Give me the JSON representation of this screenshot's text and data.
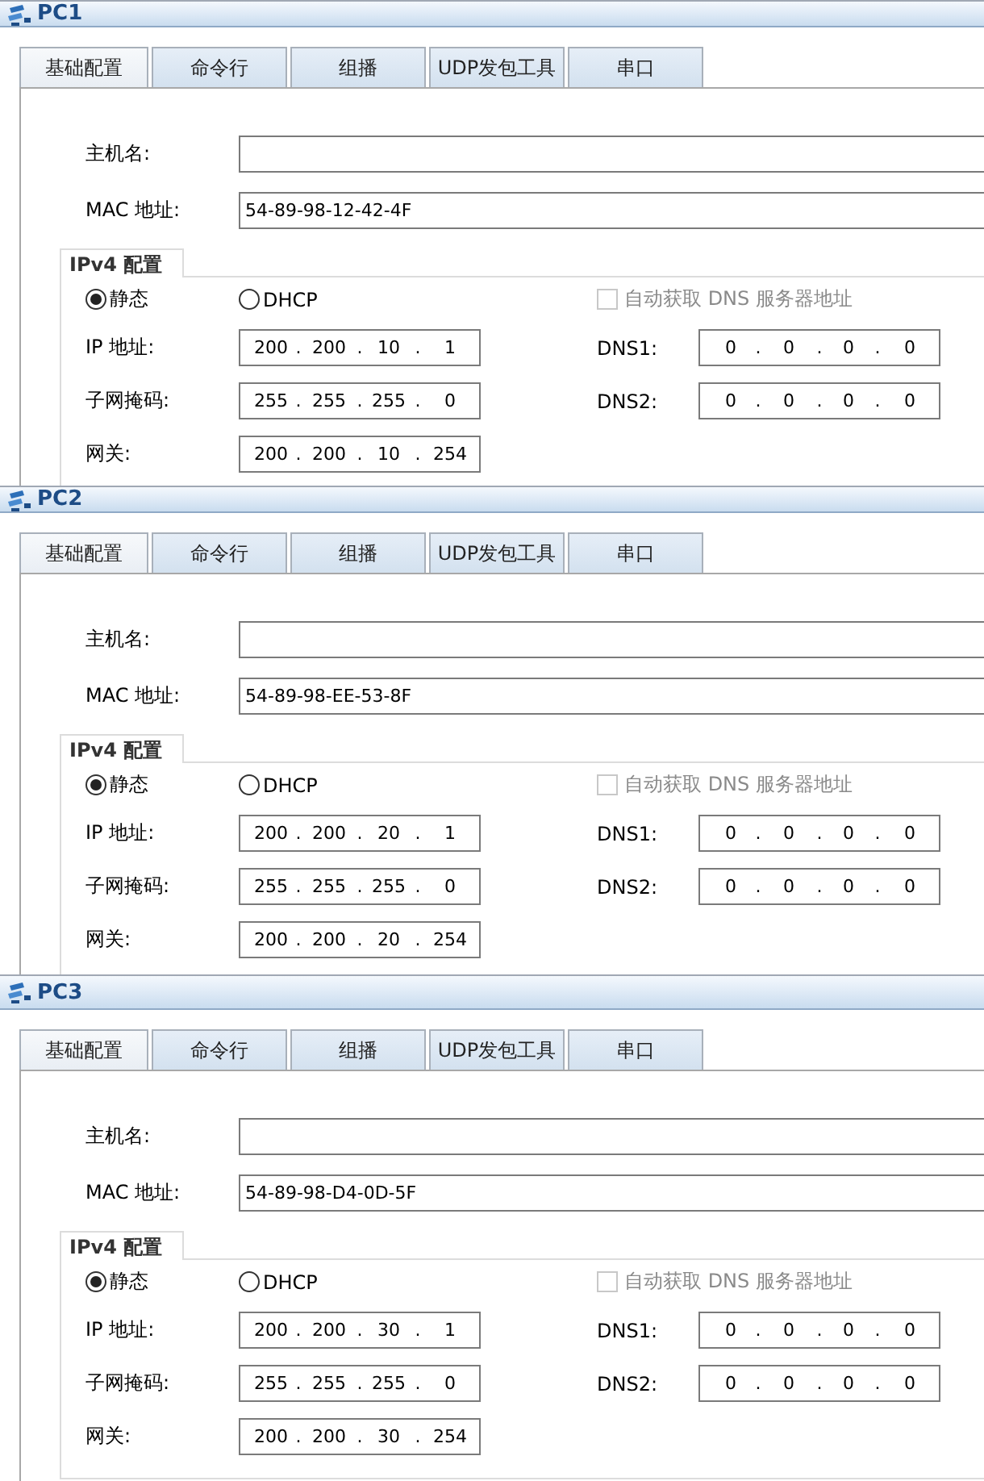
{
  "octet_separator": ".",
  "panels": [
    {
      "title": "PC1",
      "tabs": [
        {
          "label": "基础配置",
          "selected": true
        },
        {
          "label": "命令行",
          "selected": false
        },
        {
          "label": "组播",
          "selected": false
        },
        {
          "label": "UDP发包工具",
          "selected": false
        },
        {
          "label": "串口",
          "selected": false
        }
      ],
      "hostname": {
        "label": "主机名:"
      },
      "mac": {
        "label": "MAC 地址:",
        "value": "54-89-98-12-42-4F"
      },
      "ipv4": {
        "legend": "IPv4 配置",
        "static": {
          "label": "静态",
          "selected": true
        },
        "dhcp": {
          "label": "DHCP",
          "selected": false
        },
        "auto_dns": {
          "label": "自动获取 DNS 服务器地址",
          "checked": false,
          "disabled": true
        },
        "ip": {
          "label": "IP 地址:",
          "octets": [
            "200",
            "200",
            "10",
            "1"
          ]
        },
        "mask": {
          "label": "子网掩码:",
          "octets": [
            "255",
            "255",
            "255",
            "0"
          ]
        },
        "gateway": {
          "label": "网关:",
          "octets": [
            "200",
            "200",
            "10",
            "254"
          ]
        },
        "dns1": {
          "label": "DNS1:",
          "octets": [
            "0",
            "0",
            "0",
            "0"
          ]
        },
        "dns2": {
          "label": "DNS2:",
          "octets": [
            "0",
            "0",
            "0",
            "0"
          ]
        }
      }
    },
    {
      "title": "PC2",
      "tabs": [
        {
          "label": "基础配置",
          "selected": true
        },
        {
          "label": "命令行",
          "selected": false
        },
        {
          "label": "组播",
          "selected": false
        },
        {
          "label": "UDP发包工具",
          "selected": false
        },
        {
          "label": "串口",
          "selected": false
        }
      ],
      "hostname": {
        "label": "主机名:"
      },
      "mac": {
        "label": "MAC 地址:",
        "value": "54-89-98-EE-53-8F"
      },
      "ipv4": {
        "legend": "IPv4 配置",
        "static": {
          "label": "静态",
          "selected": true
        },
        "dhcp": {
          "label": "DHCP",
          "selected": false
        },
        "auto_dns": {
          "label": "自动获取 DNS 服务器地址",
          "checked": false,
          "disabled": true
        },
        "ip": {
          "label": "IP 地址:",
          "octets": [
            "200",
            "200",
            "20",
            "1"
          ]
        },
        "mask": {
          "label": "子网掩码:",
          "octets": [
            "255",
            "255",
            "255",
            "0"
          ]
        },
        "gateway": {
          "label": "网关:",
          "octets": [
            "200",
            "200",
            "20",
            "254"
          ]
        },
        "dns1": {
          "label": "DNS1:",
          "octets": [
            "0",
            "0",
            "0",
            "0"
          ]
        },
        "dns2": {
          "label": "DNS2:",
          "octets": [
            "0",
            "0",
            "0",
            "0"
          ]
        }
      }
    },
    {
      "title": "PC3",
      "tabs": [
        {
          "label": "基础配置",
          "selected": true
        },
        {
          "label": "命令行",
          "selected": false
        },
        {
          "label": "组播",
          "selected": false
        },
        {
          "label": "UDP发包工具",
          "selected": false
        },
        {
          "label": "串口",
          "selected": false
        }
      ],
      "hostname": {
        "label": "主机名:"
      },
      "mac": {
        "label": "MAC 地址:",
        "value": "54-89-98-D4-0D-5F"
      },
      "ipv4": {
        "legend": "IPv4 配置",
        "static": {
          "label": "静态",
          "selected": true
        },
        "dhcp": {
          "label": "DHCP",
          "selected": false
        },
        "auto_dns": {
          "label": "自动获取 DNS 服务器地址",
          "checked": false,
          "disabled": true
        },
        "ip": {
          "label": "IP 地址:",
          "octets": [
            "200",
            "200",
            "30",
            "1"
          ]
        },
        "mask": {
          "label": "子网掩码:",
          "octets": [
            "255",
            "255",
            "255",
            "0"
          ]
        },
        "gateway": {
          "label": "网关:",
          "octets": [
            "200",
            "200",
            "30",
            "254"
          ]
        },
        "dns1": {
          "label": "DNS1:",
          "octets": [
            "0",
            "0",
            "0",
            "0"
          ]
        },
        "dns2": {
          "label": "DNS2:",
          "octets": [
            "0",
            "0",
            "0",
            "0"
          ]
        }
      }
    }
  ]
}
